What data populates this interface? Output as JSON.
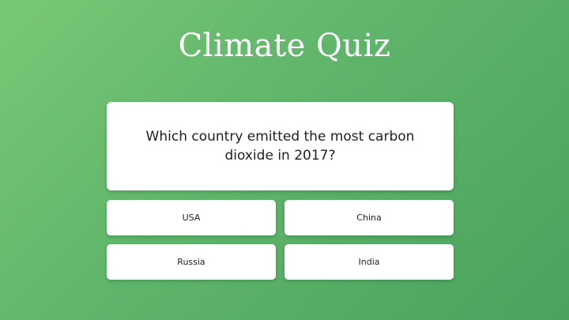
{
  "quiz": {
    "title": "Climate Quiz",
    "question": "Which country emitted the most carbon dioxide in 2017?",
    "answers": [
      {
        "label": "USA"
      },
      {
        "label": "China"
      },
      {
        "label": "Russia"
      },
      {
        "label": "India"
      }
    ]
  },
  "colors": {
    "background_start": "#79c876",
    "background_end": "#4aa25d",
    "card": "#ffffff",
    "text": "#1f1f1f"
  }
}
